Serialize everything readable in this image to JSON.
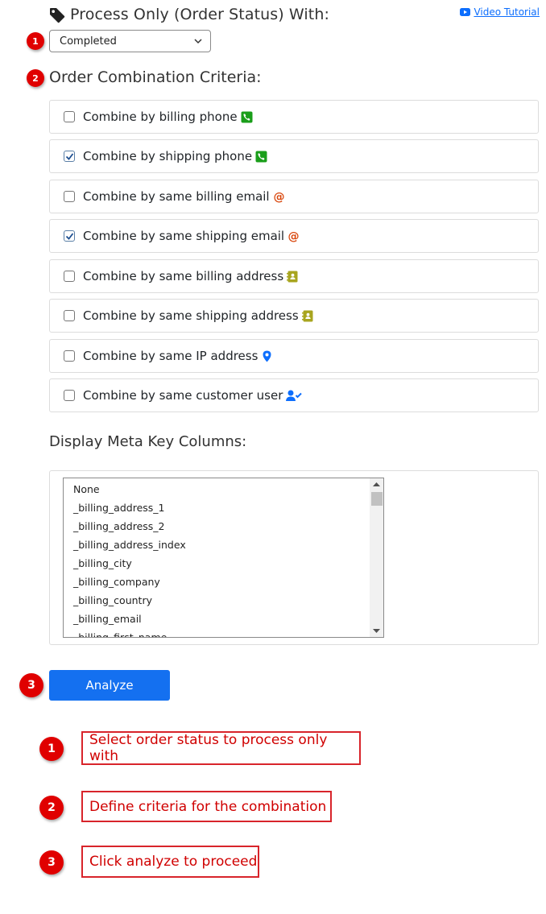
{
  "header": {
    "title": "Process Only (Order Status) With:",
    "video_link": "Video Tutorial",
    "tag_icon": "tag-icon",
    "video_icon": "youtube-icon"
  },
  "status_select": {
    "value": "Completed",
    "badge": "1"
  },
  "criteria": {
    "title": "Order Combination Criteria:",
    "badge": "2",
    "items": [
      {
        "label": "Combine by billing phone",
        "checked": false,
        "icon": "phone-icon",
        "icon_color": "#1a9e1a"
      },
      {
        "label": "Combine by shipping phone",
        "checked": true,
        "icon": "phone-icon",
        "icon_color": "#1a9e1a"
      },
      {
        "label": "Combine by same billing email",
        "checked": false,
        "icon": "at-icon",
        "icon_color": "#d9480f"
      },
      {
        "label": "Combine by same shipping email",
        "checked": true,
        "icon": "at-icon",
        "icon_color": "#d9480f"
      },
      {
        "label": "Combine by same billing address",
        "checked": false,
        "icon": "address-book-icon",
        "icon_color": "#a8a51f"
      },
      {
        "label": "Combine by same shipping address",
        "checked": false,
        "icon": "address-book-icon",
        "icon_color": "#a8a51f"
      },
      {
        "label": "Combine by same IP address",
        "checked": false,
        "icon": "map-marker-icon",
        "icon_color": "#0d6efd"
      },
      {
        "label": "Combine by same customer user",
        "checked": false,
        "icon": "user-check-icon",
        "icon_color": "#0d6efd"
      }
    ]
  },
  "meta": {
    "title": "Display Meta Key Columns:",
    "options": [
      "None",
      "_billing_address_1",
      "_billing_address_2",
      "_billing_address_index",
      "_billing_city",
      "_billing_company",
      "_billing_country",
      "_billing_email",
      "_billing_first_name"
    ]
  },
  "analyze": {
    "label": "Analyze",
    "badge": "3"
  },
  "legend": [
    {
      "num": "1",
      "text": "Select order status to process only with"
    },
    {
      "num": "2",
      "text": "Define criteria for the combination"
    },
    {
      "num": "3",
      "text": "Click analyze to proceed"
    }
  ],
  "colors": {
    "accent": "#1470f0",
    "badge": "#e00000",
    "legend_border": "#d8242b"
  }
}
